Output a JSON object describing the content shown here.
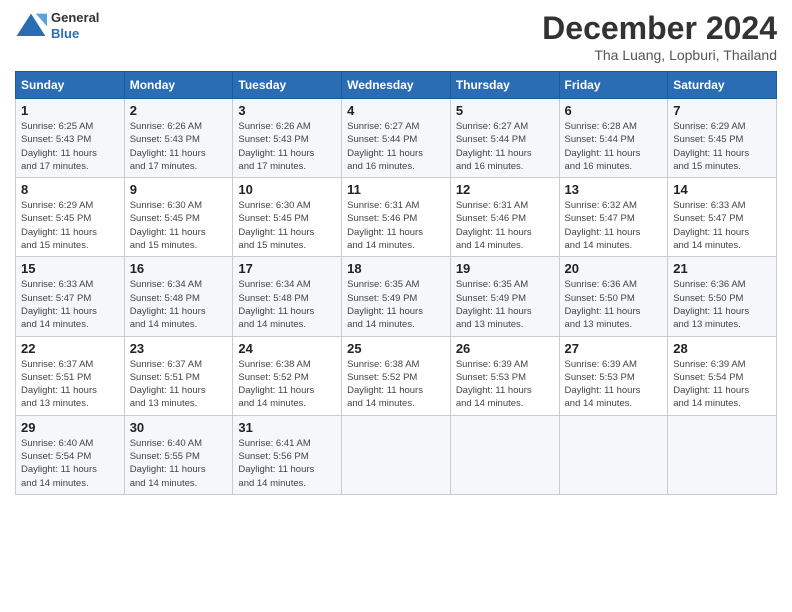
{
  "logo": {
    "general": "General",
    "blue": "Blue"
  },
  "header": {
    "month_year": "December 2024",
    "location": "Tha Luang, Lopburi, Thailand"
  },
  "weekdays": [
    "Sunday",
    "Monday",
    "Tuesday",
    "Wednesday",
    "Thursday",
    "Friday",
    "Saturday"
  ],
  "weeks": [
    [
      {
        "day": "1",
        "info": "Sunrise: 6:25 AM\nSunset: 5:43 PM\nDaylight: 11 hours\nand 17 minutes."
      },
      {
        "day": "2",
        "info": "Sunrise: 6:26 AM\nSunset: 5:43 PM\nDaylight: 11 hours\nand 17 minutes."
      },
      {
        "day": "3",
        "info": "Sunrise: 6:26 AM\nSunset: 5:43 PM\nDaylight: 11 hours\nand 17 minutes."
      },
      {
        "day": "4",
        "info": "Sunrise: 6:27 AM\nSunset: 5:44 PM\nDaylight: 11 hours\nand 16 minutes."
      },
      {
        "day": "5",
        "info": "Sunrise: 6:27 AM\nSunset: 5:44 PM\nDaylight: 11 hours\nand 16 minutes."
      },
      {
        "day": "6",
        "info": "Sunrise: 6:28 AM\nSunset: 5:44 PM\nDaylight: 11 hours\nand 16 minutes."
      },
      {
        "day": "7",
        "info": "Sunrise: 6:29 AM\nSunset: 5:45 PM\nDaylight: 11 hours\nand 15 minutes."
      }
    ],
    [
      {
        "day": "8",
        "info": "Sunrise: 6:29 AM\nSunset: 5:45 PM\nDaylight: 11 hours\nand 15 minutes."
      },
      {
        "day": "9",
        "info": "Sunrise: 6:30 AM\nSunset: 5:45 PM\nDaylight: 11 hours\nand 15 minutes."
      },
      {
        "day": "10",
        "info": "Sunrise: 6:30 AM\nSunset: 5:45 PM\nDaylight: 11 hours\nand 15 minutes."
      },
      {
        "day": "11",
        "info": "Sunrise: 6:31 AM\nSunset: 5:46 PM\nDaylight: 11 hours\nand 14 minutes."
      },
      {
        "day": "12",
        "info": "Sunrise: 6:31 AM\nSunset: 5:46 PM\nDaylight: 11 hours\nand 14 minutes."
      },
      {
        "day": "13",
        "info": "Sunrise: 6:32 AM\nSunset: 5:47 PM\nDaylight: 11 hours\nand 14 minutes."
      },
      {
        "day": "14",
        "info": "Sunrise: 6:33 AM\nSunset: 5:47 PM\nDaylight: 11 hours\nand 14 minutes."
      }
    ],
    [
      {
        "day": "15",
        "info": "Sunrise: 6:33 AM\nSunset: 5:47 PM\nDaylight: 11 hours\nand 14 minutes."
      },
      {
        "day": "16",
        "info": "Sunrise: 6:34 AM\nSunset: 5:48 PM\nDaylight: 11 hours\nand 14 minutes."
      },
      {
        "day": "17",
        "info": "Sunrise: 6:34 AM\nSunset: 5:48 PM\nDaylight: 11 hours\nand 14 minutes."
      },
      {
        "day": "18",
        "info": "Sunrise: 6:35 AM\nSunset: 5:49 PM\nDaylight: 11 hours\nand 14 minutes."
      },
      {
        "day": "19",
        "info": "Sunrise: 6:35 AM\nSunset: 5:49 PM\nDaylight: 11 hours\nand 13 minutes."
      },
      {
        "day": "20",
        "info": "Sunrise: 6:36 AM\nSunset: 5:50 PM\nDaylight: 11 hours\nand 13 minutes."
      },
      {
        "day": "21",
        "info": "Sunrise: 6:36 AM\nSunset: 5:50 PM\nDaylight: 11 hours\nand 13 minutes."
      }
    ],
    [
      {
        "day": "22",
        "info": "Sunrise: 6:37 AM\nSunset: 5:51 PM\nDaylight: 11 hours\nand 13 minutes."
      },
      {
        "day": "23",
        "info": "Sunrise: 6:37 AM\nSunset: 5:51 PM\nDaylight: 11 hours\nand 13 minutes."
      },
      {
        "day": "24",
        "info": "Sunrise: 6:38 AM\nSunset: 5:52 PM\nDaylight: 11 hours\nand 14 minutes."
      },
      {
        "day": "25",
        "info": "Sunrise: 6:38 AM\nSunset: 5:52 PM\nDaylight: 11 hours\nand 14 minutes."
      },
      {
        "day": "26",
        "info": "Sunrise: 6:39 AM\nSunset: 5:53 PM\nDaylight: 11 hours\nand 14 minutes."
      },
      {
        "day": "27",
        "info": "Sunrise: 6:39 AM\nSunset: 5:53 PM\nDaylight: 11 hours\nand 14 minutes."
      },
      {
        "day": "28",
        "info": "Sunrise: 6:39 AM\nSunset: 5:54 PM\nDaylight: 11 hours\nand 14 minutes."
      }
    ],
    [
      {
        "day": "29",
        "info": "Sunrise: 6:40 AM\nSunset: 5:54 PM\nDaylight: 11 hours\nand 14 minutes."
      },
      {
        "day": "30",
        "info": "Sunrise: 6:40 AM\nSunset: 5:55 PM\nDaylight: 11 hours\nand 14 minutes."
      },
      {
        "day": "31",
        "info": "Sunrise: 6:41 AM\nSunset: 5:56 PM\nDaylight: 11 hours\nand 14 minutes."
      },
      {
        "day": "",
        "info": ""
      },
      {
        "day": "",
        "info": ""
      },
      {
        "day": "",
        "info": ""
      },
      {
        "day": "",
        "info": ""
      }
    ]
  ]
}
